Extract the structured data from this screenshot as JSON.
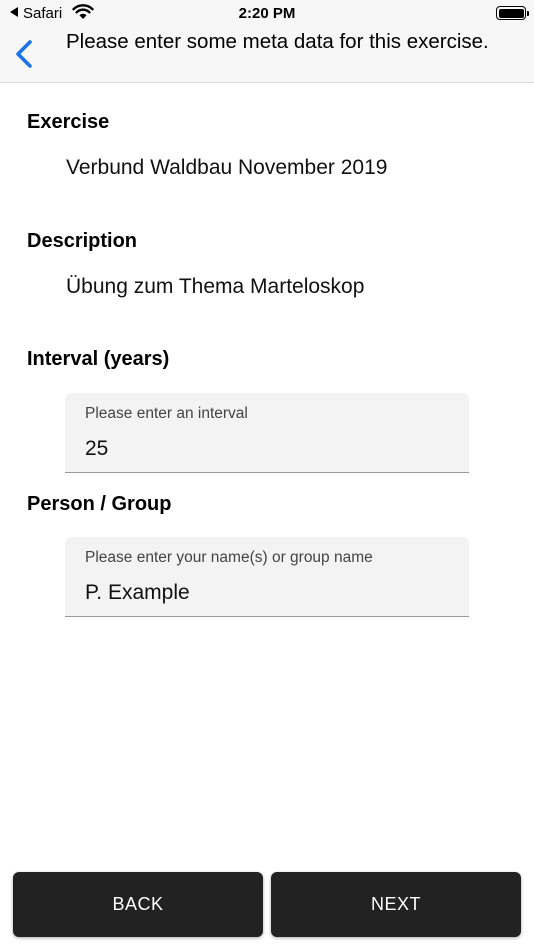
{
  "status_bar": {
    "back_app": "Safari",
    "time": "2:20 PM"
  },
  "nav": {
    "title": "Please enter some meta data for this exercise."
  },
  "exercise": {
    "label": "Exercise",
    "value": "Verbund Waldbau November 2019"
  },
  "description": {
    "label": "Description",
    "value": "Übung zum Thema Marteloskop"
  },
  "interval": {
    "label": "Interval (years)",
    "field_label": "Please enter an interval",
    "value": "25"
  },
  "person": {
    "label": "Person / Group",
    "field_label": "Please enter your name(s) or group name",
    "value": "P. Example"
  },
  "buttons": {
    "back": "BACK",
    "next": "NEXT"
  },
  "colors": {
    "accent": "#1a73e8",
    "button_bg": "#222222",
    "field_bg": "#f3f3f3"
  }
}
